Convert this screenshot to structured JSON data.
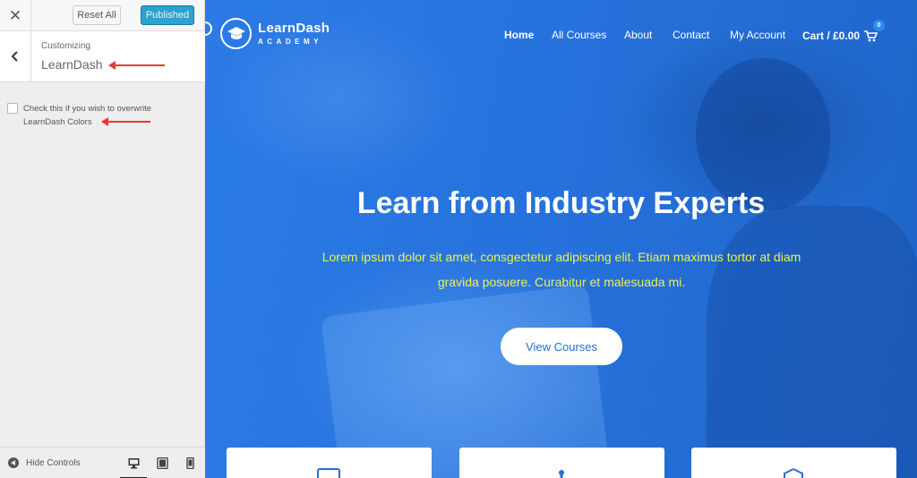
{
  "customizer": {
    "close_icon": "close-icon",
    "reset_label": "Reset All",
    "publish_label": "Published",
    "back_icon": "chevron-left-icon",
    "customizing_label": "Customizing",
    "section_title": "LearnDash",
    "option_label": "Check this if you wish to overwrite LearnDash Colors",
    "option_checked": false,
    "hide_controls_label": "Hide Controls",
    "devices": [
      {
        "name": "desktop",
        "active": true
      },
      {
        "name": "tablet",
        "active": false
      },
      {
        "name": "mobile",
        "active": false
      }
    ],
    "colors": {
      "publish": "#2ea2cc",
      "annotation_arrow": "#e53935"
    }
  },
  "site": {
    "logo_name": "LearnDash",
    "logo_sub": "ACADEMY",
    "nav": [
      "Home",
      "All Courses",
      "About",
      "Contact",
      "My Account"
    ],
    "active_nav": "Home",
    "cart_label": "Cart / £0.00",
    "cart_count": "0",
    "hero_title": "Learn from Industry Experts",
    "hero_text": "Lorem ipsum dolor sit amet, consgectetur adipiscing elit. Etiam maximus tortor at diam gravida posuere. Curabitur et malesuada mi.",
    "cta_label": "View Courses",
    "colors": {
      "hero_blue": "#1f6fd6",
      "hero_text": "#e9f255"
    },
    "card_icons": [
      "monitor-icon",
      "puzzle-icon",
      "shield-icon"
    ]
  }
}
